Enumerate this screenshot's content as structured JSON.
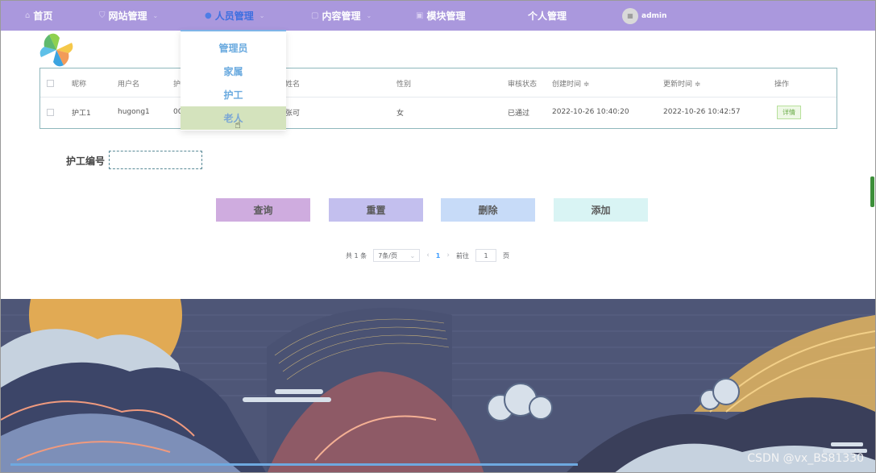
{
  "nav": {
    "home": "首页",
    "website": "网站管理",
    "personnel": "人员管理",
    "content": "内容管理",
    "module": "模块管理",
    "personal": "个人管理",
    "user": "admin"
  },
  "dropdown": {
    "items": [
      "管理员",
      "家属",
      "护工",
      "老人"
    ],
    "hovered": "老人"
  },
  "table": {
    "headers": [
      "昵称",
      "用户名",
      "护",
      "姓名",
      "性别",
      "审核状态",
      "创建时间 ≑",
      "更新时间 ≑",
      "操作"
    ],
    "rows": [
      {
        "nickname": "护工1",
        "username": "hugong1",
        "code": "00",
        "name": "张可",
        "gender": "女",
        "status": "已通过",
        "created": "2022-10-26 10:40:20",
        "updated": "2022-10-26 10:42:57",
        "action": "详情"
      }
    ]
  },
  "search": {
    "label": "护工编号",
    "value": ""
  },
  "buttons": {
    "query": "查询",
    "reset": "重置",
    "delete": "删除",
    "add": "添加"
  },
  "pager": {
    "total": "共 1 条",
    "page_size": "7条/页",
    "current": "1",
    "goto": "前往",
    "goto_value": "1",
    "page_suffix": "页"
  },
  "watermark": "CSDN @vx_BS81330",
  "colors": {
    "nav_bg": "#aa98dd",
    "accent": "#409eff",
    "dropdown_hover": "#d4e3bd"
  }
}
